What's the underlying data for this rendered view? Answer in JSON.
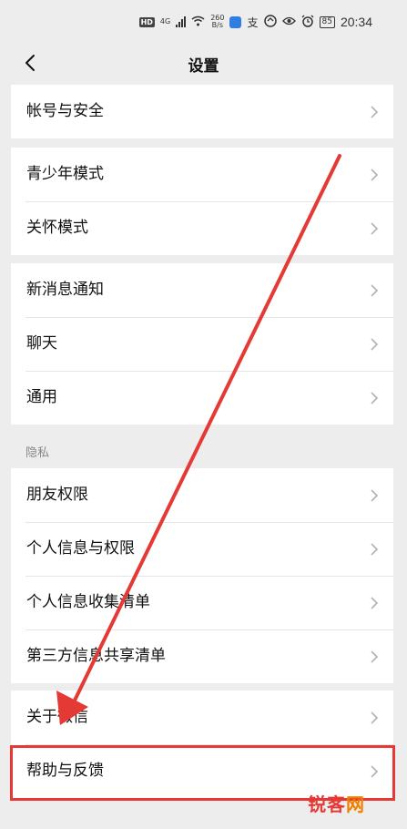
{
  "status_bar": {
    "hd": "HD",
    "network": "4G",
    "speed_value": "260",
    "speed_unit": "B/s",
    "alipay_icon_text": "支",
    "battery": "85",
    "time": "20:34"
  },
  "navbar": {
    "title": "设置"
  },
  "groups": [
    {
      "rows": [
        "帐号与安全"
      ]
    },
    {
      "rows": [
        "青少年模式",
        "关怀模式"
      ]
    },
    {
      "rows": [
        "新消息通知",
        "聊天",
        "通用"
      ]
    },
    {
      "section_label": "隐私",
      "rows": [
        "朋友权限",
        "个人信息与权限",
        "个人信息收集清单",
        "第三方信息共享清单"
      ]
    },
    {
      "rows": [
        "关于微信",
        "帮助与反馈"
      ]
    }
  ],
  "annotation": {
    "highlighted_row": "帮助与反馈",
    "color": "#e53935"
  },
  "watermark": {
    "part1": "锐客",
    "part2": "网"
  }
}
